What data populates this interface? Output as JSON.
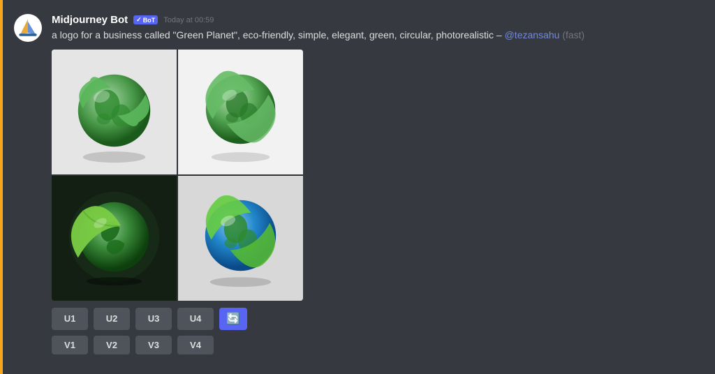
{
  "accent": {
    "color": "#faa61a"
  },
  "message": {
    "username": "Midjourney Bot",
    "bot_badge": "BoT",
    "checkmark": "✓",
    "timestamp": "Today at 00:59",
    "prompt": "a logo for a business called \"Green Planet\", eco-friendly, simple, elegant, green, circular, photorealistic",
    "dash": "–",
    "mention": "@tezansahu",
    "speed_label": "(fast)"
  },
  "buttons_row1": [
    {
      "label": "U1",
      "name": "u1-button"
    },
    {
      "label": "U2",
      "name": "u2-button"
    },
    {
      "label": "U3",
      "name": "u3-button"
    },
    {
      "label": "U4",
      "name": "u4-button"
    }
  ],
  "buttons_row2": [
    {
      "label": "V1",
      "name": "v1-button"
    },
    {
      "label": "V2",
      "name": "v2-button"
    },
    {
      "label": "V3",
      "name": "v3-button"
    },
    {
      "label": "V4",
      "name": "v4-button"
    }
  ],
  "refresh_icon": "🔄",
  "colors": {
    "background": "#36393f",
    "sidebar": "#2f3136",
    "button_bg": "#4f545c",
    "refresh_bg": "#5865f2"
  }
}
